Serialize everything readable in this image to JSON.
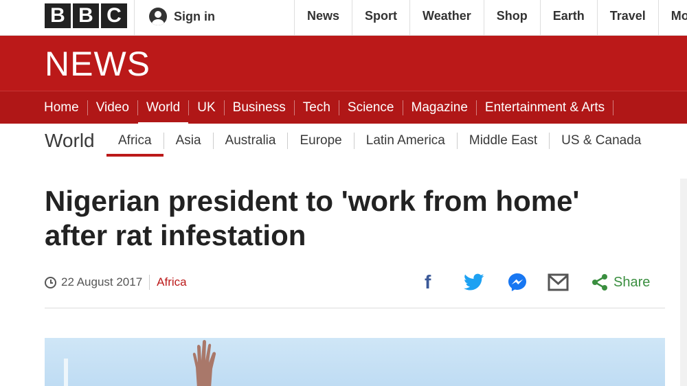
{
  "topbar": {
    "logo_letters": [
      "B",
      "B",
      "C"
    ],
    "sign_in": "Sign in",
    "nav": [
      "News",
      "Sport",
      "Weather",
      "Shop",
      "Earth",
      "Travel",
      "Mor"
    ]
  },
  "newsband": {
    "wordmark": "NEWS"
  },
  "mainnav": {
    "items": [
      "Home",
      "Video",
      "World",
      "UK",
      "Business",
      "Tech",
      "Science",
      "Magazine",
      "Entertainment & Arts"
    ],
    "active": "World"
  },
  "section": {
    "title": "World",
    "items": [
      "Africa",
      "Asia",
      "Australia",
      "Europe",
      "Latin America",
      "Middle East",
      "US & Canada"
    ],
    "active": "Africa"
  },
  "article": {
    "headline_line1": "Nigerian president to 'work from home'",
    "headline_line2": "after rat infestation",
    "date": "22 August 2017",
    "category": "Africa"
  },
  "share": {
    "icons": [
      "facebook-icon",
      "twitter-icon",
      "messenger-icon",
      "email-icon"
    ],
    "label": "Share"
  },
  "colors": {
    "brand_red": "#bb1919",
    "share_green": "#3a8e3f",
    "facebook_blue": "#3b5998",
    "twitter_blue": "#1da1f2"
  }
}
